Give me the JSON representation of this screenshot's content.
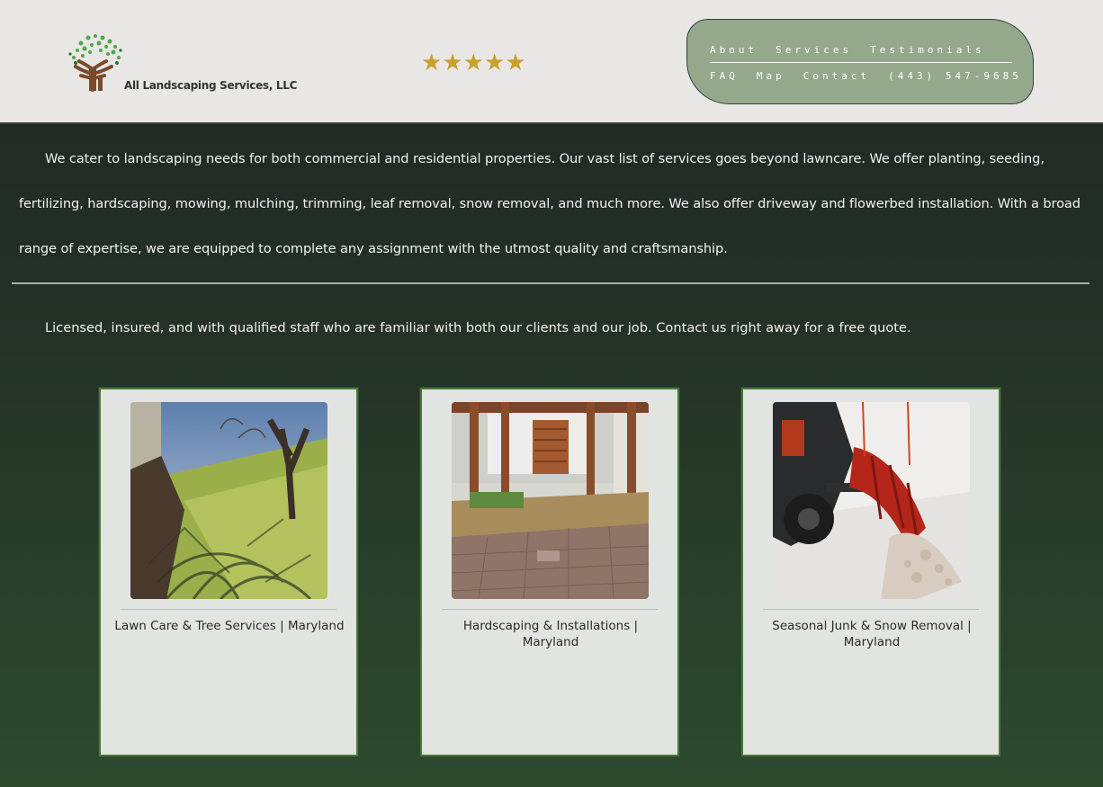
{
  "header": {
    "logo_text": "All Landscaping Services, LLC",
    "rating_stars": 5,
    "nav_row1": [
      "About",
      "Services",
      "Testimonials"
    ],
    "nav_row2": [
      "FAQ",
      "Map",
      "Contact",
      "(443) 547-9685"
    ]
  },
  "main": {
    "intro": "We cater to landscaping needs for both commercial and residential properties. Our vast list of services goes beyond lawncare. We offer planting, seeding, fertilizing, hardscaping, mowing, mulching, trimming, leaf removal, snow removal, and much more. We also offer driveway and flowerbed installation. With a broad range of expertise, we are equipped to complete any assignment with the utmost quality and craftsmanship.",
    "licensed": "Licensed, insured, and with qualified staff who are familiar with both our clients and our job. Contact us right away for a free quote."
  },
  "cards": [
    {
      "title": "Lawn Care & Tree Services | Maryland"
    },
    {
      "title": "Hardscaping & Installations | Maryland"
    },
    {
      "title": "Seasonal Junk & Snow Removal | Maryland"
    }
  ],
  "colors": {
    "star": "#c9a02c",
    "nav_bg": "#94a88b",
    "card_border": "#477a37"
  }
}
